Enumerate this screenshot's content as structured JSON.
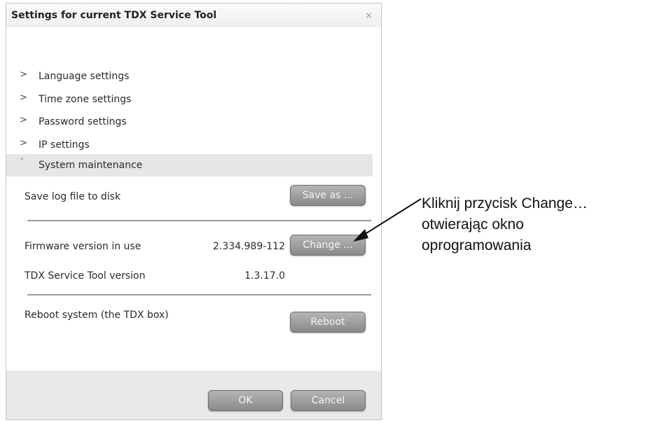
{
  "dialog": {
    "title": "Settings for current TDX Service Tool",
    "close_glyph": "⨯",
    "close_icon": "close-icon"
  },
  "nav": {
    "items": [
      {
        "label": "Language settings",
        "chevron": ">",
        "icon": "chevron-right-icon"
      },
      {
        "label": "Time zone settings",
        "chevron": ">",
        "icon": "chevron-right-icon"
      },
      {
        "label": "Password settings",
        "chevron": ">",
        "icon": "chevron-right-icon"
      },
      {
        "label": "IP settings",
        "chevron": ">",
        "icon": "chevron-right-icon"
      },
      {
        "label": "System maintenance",
        "chevron": "˅",
        "icon": "chevron-down-icon",
        "expanded": true
      }
    ]
  },
  "maintenance": {
    "save_log_label": "Save log file to disk",
    "save_as_button": "Save as ...",
    "firmware_label": "Firmware version in use",
    "firmware_value": "2.334.989-112",
    "change_button": "Change ...",
    "tool_version_label": "TDX Service Tool version",
    "tool_version_value": "1.3.17.0",
    "reboot_label": "Reboot system (the TDX box)",
    "reboot_button": "Reboot"
  },
  "footer": {
    "ok_button": "OK",
    "cancel_button": "Cancel"
  },
  "annotation": {
    "lines": [
      "Kliknij przycisk Change…",
      "otwierając okno",
      "oprogramowania"
    ]
  },
  "colors": {
    "button_top": "#b5b5b5",
    "button_bottom": "#8a8a8a",
    "expanded_row": "#e6e6e6",
    "footer": "#e9e9e9"
  }
}
